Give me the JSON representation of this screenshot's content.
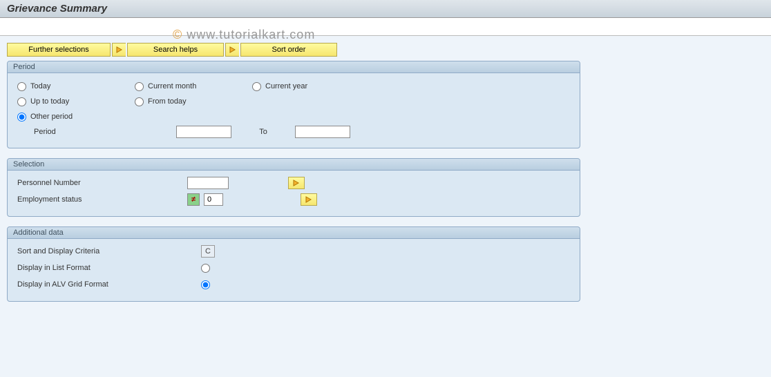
{
  "header": {
    "title": "Grievance Summary"
  },
  "watermark": "www.tutorialkart.com",
  "toolbar": {
    "further_selections": "Further selections",
    "search_helps": "Search helps",
    "sort_order": "Sort order"
  },
  "period": {
    "legend": "Period",
    "today": "Today",
    "current_month": "Current month",
    "current_year": "Current year",
    "up_to_today": "Up to today",
    "from_today": "From today",
    "other_period": "Other period",
    "period_label": "Period",
    "to_label": "To",
    "period_from": "",
    "period_to": "",
    "selected": "other_period"
  },
  "selection": {
    "legend": "Selection",
    "personnel_number_label": "Personnel Number",
    "personnel_number_value": "",
    "employment_status_label": "Employment status",
    "employment_status_value": "0"
  },
  "additional": {
    "legend": "Additional data",
    "sort_display_label": "Sort and Display Criteria",
    "sort_display_value": "C",
    "list_format_label": "Display in List Format",
    "alv_format_label": "Display in ALV Grid Format",
    "display_selected": "alv"
  }
}
